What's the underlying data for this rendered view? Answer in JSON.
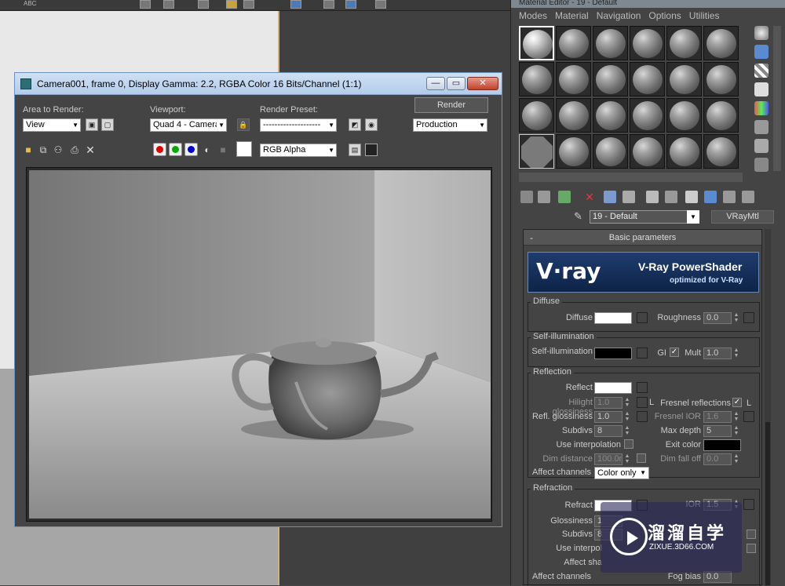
{
  "background": {
    "top_toolbar_text": "ABC"
  },
  "material_editor": {
    "title": "Material Editor - 19 - Default",
    "menu": [
      "Modes",
      "Material",
      "Navigation",
      "Options",
      "Utilities"
    ],
    "material_name": "19 - Default",
    "material_type": "VRayMtl",
    "rollout_title": "Basic parameters",
    "rollout_toggle": "-",
    "banner": {
      "logo": "V·ray",
      "title": "V-Ray PowerShader",
      "subtitle": "optimized for V-Ray"
    },
    "diffuse": {
      "group": "Diffuse",
      "label": "Diffuse",
      "roughness_label": "Roughness",
      "roughness": "0.0"
    },
    "self_illum": {
      "group": "Self-illumination",
      "label": "Self-illumination",
      "gi_label": "GI",
      "mult_label": "Mult",
      "mult": "1.0"
    },
    "reflection": {
      "group": "Reflection",
      "reflect_label": "Reflect",
      "hilight_label": "Hilight glossiness",
      "hilight": "1.0",
      "hilight_lock": "L",
      "fresnel_label": "Fresnel reflections",
      "fresnel_lock": "L",
      "refl_gloss_label": "Refl. glossiness",
      "refl_gloss": "1.0",
      "fresnel_ior_label": "Fresnel IOR",
      "fresnel_ior": "1.6",
      "subdivs_label": "Subdivs",
      "subdivs": "8",
      "max_depth_label": "Max depth",
      "max_depth": "5",
      "use_interp_label": "Use interpolation",
      "exit_color_label": "Exit color",
      "dim_distance_label": "Dim distance",
      "dim_distance": "100.0n",
      "dim_falloff_label": "Dim fall off",
      "dim_falloff": "0.0",
      "affect_channels_label": "Affect channels",
      "affect_channels": "Color only"
    },
    "refraction": {
      "group": "Refraction",
      "refract_label": "Refract",
      "ior_label": "IOR",
      "ior": "1.5",
      "glossiness_label": "Glossiness",
      "glossiness": "1",
      "subdivs_label": "Subdivs",
      "subdivs": "8",
      "use_interp_label": "Use interpol",
      "affect_shadows_label": "Affect sha",
      "affect_channels_label": "Affect channels",
      "fog_bias_label": "Fog bias",
      "fog_bias": "0.0"
    },
    "colors": {
      "diffuse": "#ffffff",
      "self_illum": "#000000",
      "reflect": "#ffffff",
      "exit": "#000000",
      "refract": "#ffffff"
    }
  },
  "render_window": {
    "title": "Camera001, frame 0, Display Gamma: 2.2, RGBA Color 16 Bits/Channel (1:1)",
    "area_label": "Area to Render:",
    "area_value": "View",
    "viewport_label": "Viewport:",
    "viewport_value": "Quad 4 - Camera(",
    "preset_label": "Render Preset:",
    "preset_value": "--------------------",
    "render_button": "Render",
    "production_value": "Production",
    "channel_value": "RGB Alpha",
    "window_buttons": {
      "minimize": "—",
      "maximize": "▭",
      "close": "✕"
    }
  },
  "watermark": {
    "cn": "溜溜自学",
    "url": "ZIXUE.3D66.COM"
  }
}
